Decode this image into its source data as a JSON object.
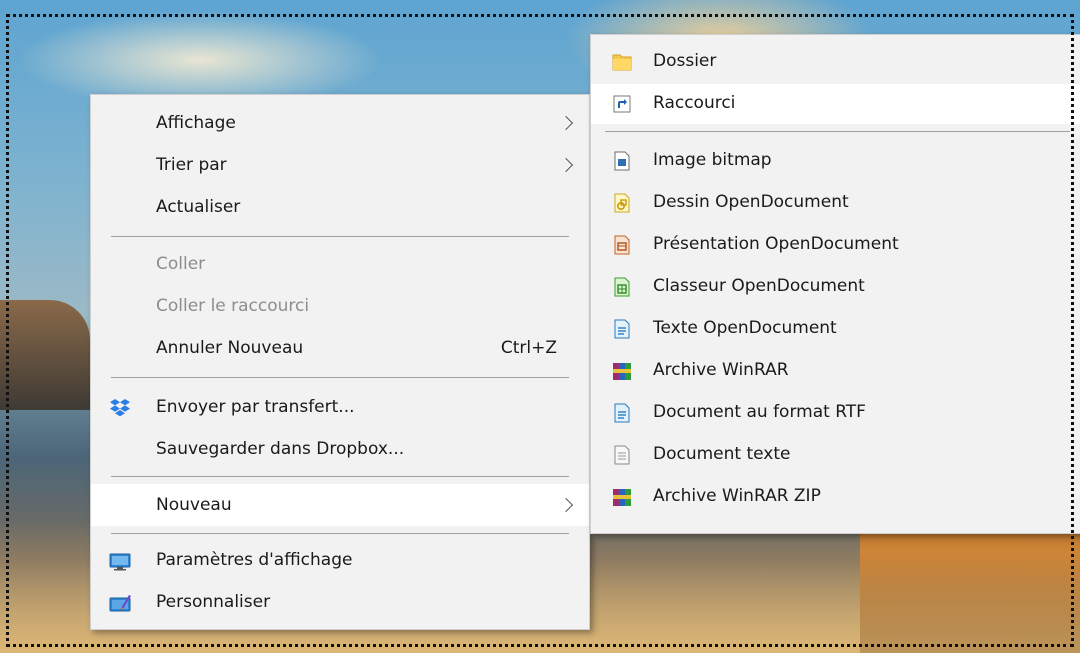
{
  "context_menu": {
    "items": [
      {
        "label": "Affichage"
      },
      {
        "label": "Trier par"
      },
      {
        "label": "Actualiser"
      },
      {
        "label": "Coller"
      },
      {
        "label": "Coller le raccourci"
      },
      {
        "label": "Annuler Nouveau",
        "shortcut": "Ctrl+Z"
      },
      {
        "label": "Envoyer par transfert..."
      },
      {
        "label": "Sauvegarder dans Dropbox..."
      },
      {
        "label": "Nouveau"
      },
      {
        "label": "Paramètres d'affichage"
      },
      {
        "label": "Personnaliser"
      }
    ]
  },
  "new_submenu": {
    "items": [
      {
        "label": "Dossier",
        "icon": "folder-icon"
      },
      {
        "label": "Raccourci",
        "icon": "shortcut-icon"
      },
      {
        "label": "Image bitmap",
        "icon": "bitmap-image-icon"
      },
      {
        "label": "Dessin OpenDocument",
        "icon": "opendocument-drawing-icon"
      },
      {
        "label": "Présentation OpenDocument",
        "icon": "opendocument-presentation-icon"
      },
      {
        "label": "Classeur OpenDocument",
        "icon": "opendocument-spreadsheet-icon"
      },
      {
        "label": "Texte OpenDocument",
        "icon": "opendocument-text-icon"
      },
      {
        "label": "Archive WinRAR",
        "icon": "winrar-archive-icon"
      },
      {
        "label": "Document au format RTF",
        "icon": "rtf-document-icon"
      },
      {
        "label": "Document texte",
        "icon": "text-document-icon"
      },
      {
        "label": "Archive WinRAR ZIP",
        "icon": "winrar-zip-icon"
      }
    ]
  },
  "colors": {
    "menu_background": "#f2f2f2",
    "highlight": "#ffffff",
    "disabled_text": "#8d8d8d"
  }
}
